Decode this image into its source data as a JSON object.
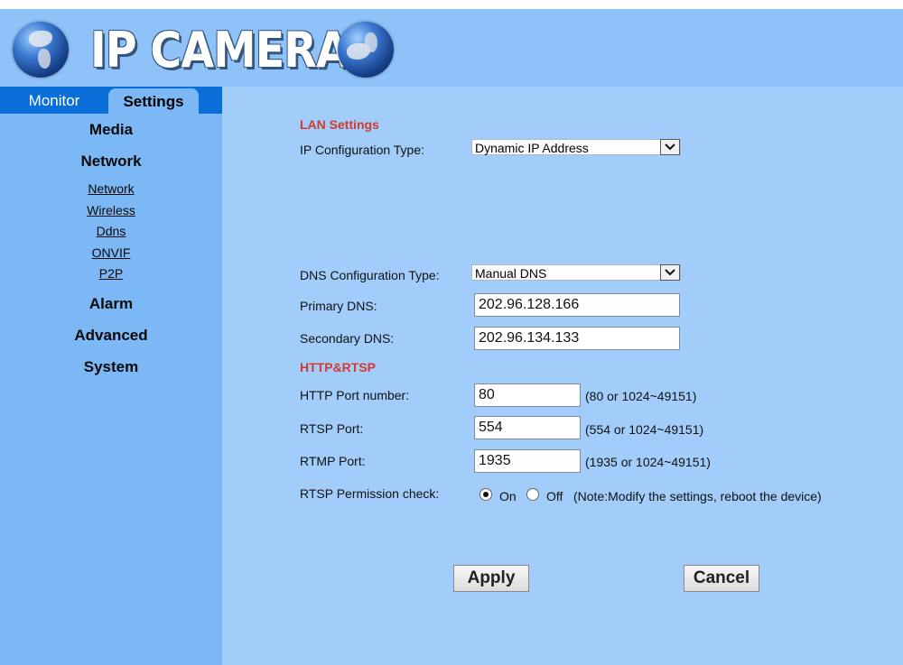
{
  "header": {
    "brand": "IP CAMERA"
  },
  "tabs": {
    "monitor": "Monitor",
    "settings": "Settings"
  },
  "sidebar": {
    "media": "Media",
    "network": "Network",
    "network_items": [
      "Network",
      "Wireless",
      "Ddns",
      "ONVIF",
      "P2P"
    ],
    "alarm": "Alarm",
    "advanced": "Advanced",
    "system": "System"
  },
  "lan": {
    "section": "LAN Settings",
    "ip_config_label": "IP Configuration Type:",
    "ip_config_value": "Dynamic IP Address",
    "dns_config_label": "DNS Configuration Type:",
    "dns_config_value": "Manual DNS",
    "primary_dns_label": "Primary DNS:",
    "primary_dns_value": "202.96.128.166",
    "secondary_dns_label": "Secondary DNS:",
    "secondary_dns_value": "202.96.134.133"
  },
  "http": {
    "section": "HTTP&RTSP",
    "http_port_label": "HTTP Port number:",
    "http_port_value": "80",
    "http_port_hint": "(80 or 1024~49151)",
    "rtsp_port_label": "RTSP Port:",
    "rtsp_port_value": "554",
    "rtsp_port_hint": "(554 or 1024~49151)",
    "rtmp_port_label": "RTMP Port:",
    "rtmp_port_value": "1935",
    "rtmp_port_hint": "(1935 or 1024~49151)",
    "rtsp_perm_label": "RTSP Permission check:",
    "on_label": "On",
    "off_label": "Off",
    "rtsp_perm_note": "(Note:Modify the settings, reboot the device)"
  },
  "actions": {
    "apply": "Apply",
    "cancel": "Cancel"
  }
}
